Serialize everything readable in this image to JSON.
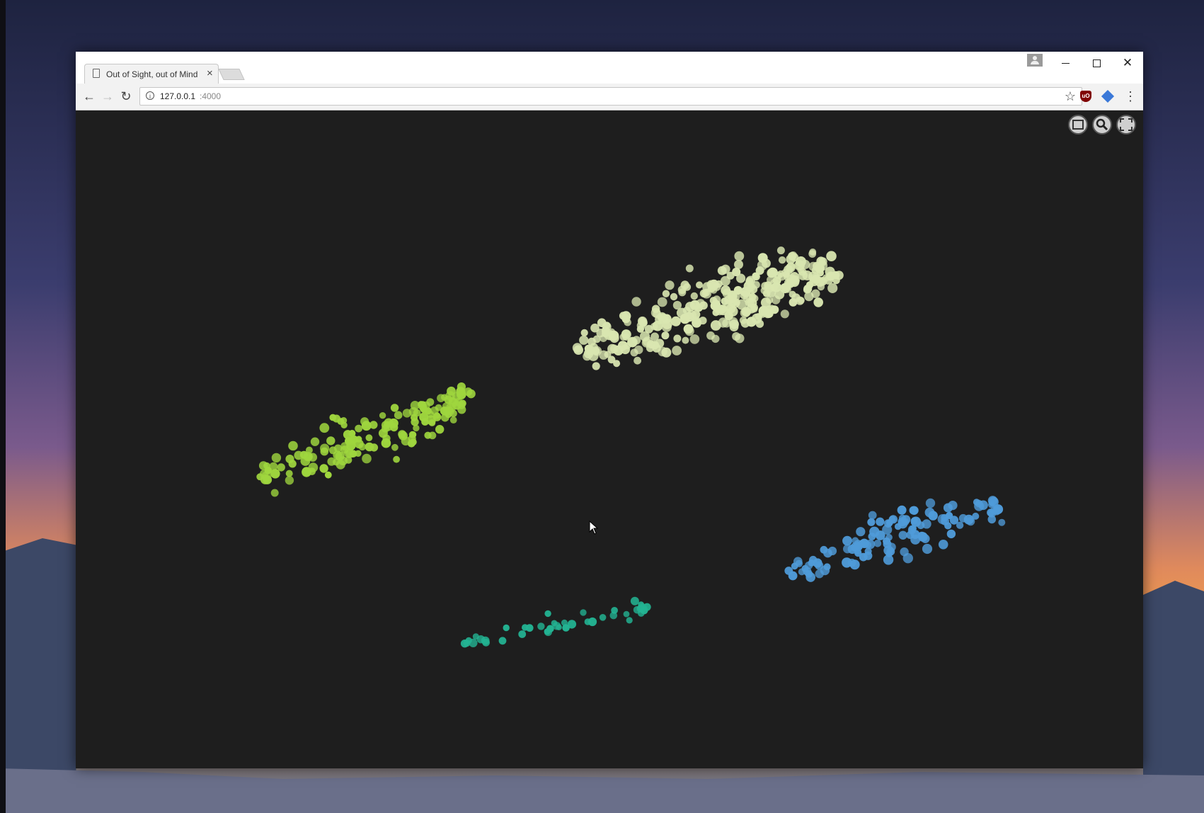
{
  "browser": {
    "tab_title": "Out of Sight, out of Mind",
    "tab_close": "×",
    "url_host": "127.0.0.1",
    "url_port": ":4000",
    "window_controls": {
      "minimize": "minimize-icon",
      "maximize": "maximize-icon",
      "close": "✕"
    },
    "nav": {
      "back": "←",
      "forward": "→",
      "reload": "↻",
      "info": "i",
      "star": "☆",
      "menu": "⋮"
    },
    "extensions": [
      {
        "name": "ublock-icon",
        "text": "uO"
      },
      {
        "name": "extension-icon"
      }
    ]
  },
  "viewer": {
    "background": "#1e1e1e",
    "controls": [
      "screenshot-control",
      "zoom-control",
      "fullscreen-control"
    ],
    "clusters": [
      {
        "name": "pale-yellow-cluster",
        "color": "#d9e6b0",
        "count": 300
      },
      {
        "name": "lime-cluster",
        "color": "#9fd63e",
        "count": 150
      },
      {
        "name": "blue-cluster",
        "color": "#4f9bd9",
        "count": 120
      },
      {
        "name": "teal-cluster",
        "color": "#23b493",
        "count": 40
      }
    ]
  }
}
